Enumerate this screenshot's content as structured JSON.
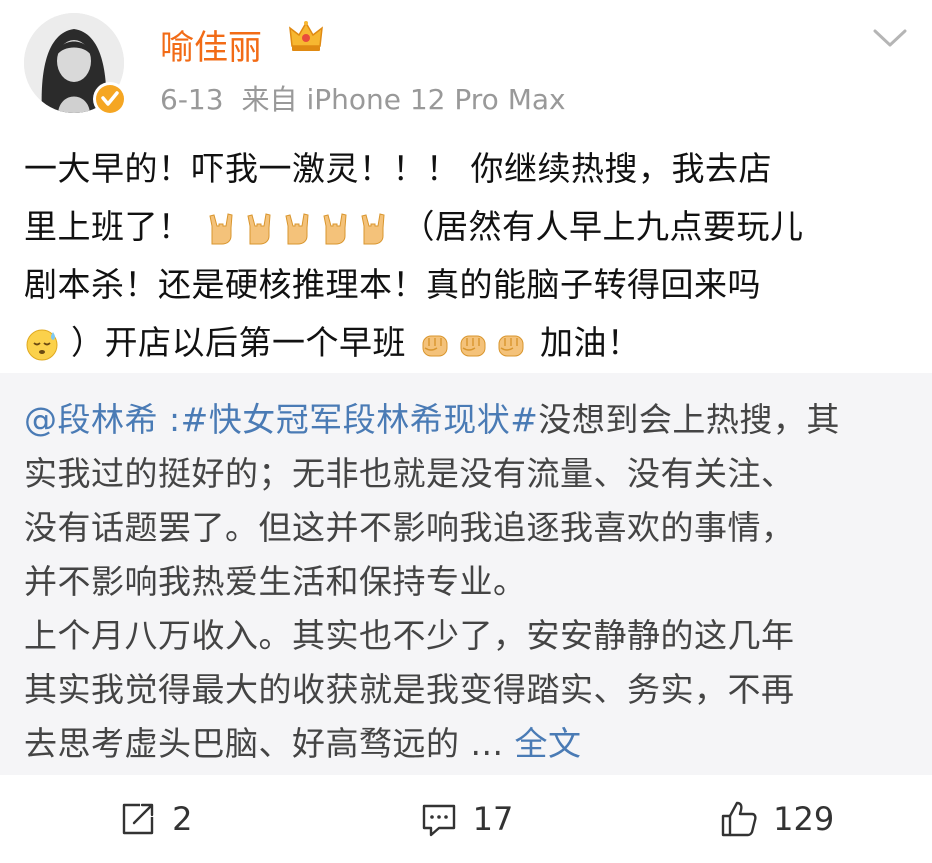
{
  "header": {
    "user_name": "喻佳丽",
    "date": "6-13",
    "source": "来自 iPhone 12 Pro Max"
  },
  "post": {
    "line1": "一大早的！吓我一激灵！！！ 你继续热搜，我去店",
    "line2_a": "里上班了！",
    "line2_b": "（居然有人早上九点要玩儿",
    "line3": "剧本杀！还是硬核推理本！真的能脑子转得回来吗",
    "line4_a": "）开店以后第一个早班",
    "line4_b": "加油！"
  },
  "repost": {
    "mention": "@段林希",
    "topic": " :#快女冠军段林希现状#",
    "line1_rest": "没想到会上热搜，其",
    "line2": "实我过的挺好的；无非也就是没有流量、没有关注、",
    "line3": "没有话题罢了。但这并不影响我追逐我喜欢的事情，",
    "line4": "并不影响我热爱生活和保持专业。",
    "line5": "上个月八万收入。其实也不少了，安安静静的这几年",
    "line6": "其实我觉得最大的收获就是我变得踏实、务实，不再",
    "line7": "去思考虚头巴脑、好高骛远的 ...",
    "full_text_link": "全文"
  },
  "actions": {
    "repost_count": "2",
    "comment_count": "17",
    "like_count": "129"
  },
  "colors": {
    "name": "#f26b16",
    "link": "#4a7bb5",
    "repost_bg": "#f5f5f7",
    "verified": "#f5a623"
  },
  "icons": [
    "crown-badge-icon",
    "verified-icon",
    "chevron-down-icon",
    "rock-hand-emoji",
    "sweat-emoji",
    "fist-emoji",
    "repost-icon",
    "comment-icon",
    "like-icon"
  ]
}
